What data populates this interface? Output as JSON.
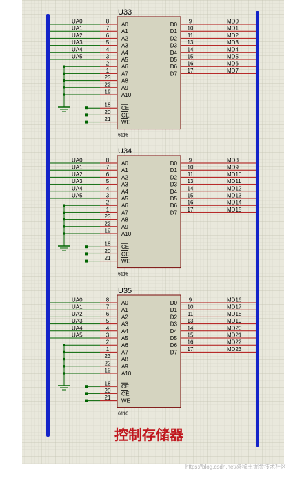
{
  "caption": "控制存储器",
  "watermark": "https://blog.csdn.net/@稀土掘金技术社区",
  "part_number": "6116",
  "colors": {
    "bus": "#1424c8",
    "wire": "#006400",
    "signal_wire": "#b01010",
    "chip_fill": "#d5d4c0",
    "grid_bg": "#e9e8dc",
    "caption": "#c0181f"
  },
  "chips": [
    {
      "title": "U33",
      "left_pins": [
        {
          "num": "8",
          "name": "A0",
          "net": "UA0"
        },
        {
          "num": "7",
          "name": "A1",
          "net": "UA1"
        },
        {
          "num": "6",
          "name": "A2",
          "net": "UA2"
        },
        {
          "num": "5",
          "name": "A3",
          "net": "UA3"
        },
        {
          "num": "4",
          "name": "A4",
          "net": "UA4"
        },
        {
          "num": "3",
          "name": "A5",
          "net": "UA5"
        },
        {
          "num": "2",
          "name": "A6",
          "net": ""
        },
        {
          "num": "1",
          "name": "A7",
          "net": ""
        },
        {
          "num": "23",
          "name": "A8",
          "net": ""
        },
        {
          "num": "22",
          "name": "A9",
          "net": ""
        },
        {
          "num": "19",
          "name": "A10",
          "net": ""
        },
        {
          "num": "18",
          "name": "CE",
          "net": ""
        },
        {
          "num": "20",
          "name": "OE",
          "net": ""
        },
        {
          "num": "21",
          "name": "WE",
          "net": ""
        }
      ],
      "right_pins": [
        {
          "num": "9",
          "name": "D0",
          "net": "MD0"
        },
        {
          "num": "10",
          "name": "D1",
          "net": "MD1"
        },
        {
          "num": "11",
          "name": "D2",
          "net": "MD2"
        },
        {
          "num": "13",
          "name": "D3",
          "net": "MD3"
        },
        {
          "num": "14",
          "name": "D4",
          "net": "MD4"
        },
        {
          "num": "15",
          "name": "D5",
          "net": "MD5"
        },
        {
          "num": "16",
          "name": "D6",
          "net": "MD6"
        },
        {
          "num": "17",
          "name": "D7",
          "net": "MD7"
        }
      ]
    },
    {
      "title": "U34",
      "left_pins": [
        {
          "num": "8",
          "name": "A0",
          "net": "UA0"
        },
        {
          "num": "7",
          "name": "A1",
          "net": "UA1"
        },
        {
          "num": "6",
          "name": "A2",
          "net": "UA2"
        },
        {
          "num": "5",
          "name": "A3",
          "net": "UA3"
        },
        {
          "num": "4",
          "name": "A4",
          "net": "UA4"
        },
        {
          "num": "3",
          "name": "A5",
          "net": "UA5"
        },
        {
          "num": "2",
          "name": "A6",
          "net": ""
        },
        {
          "num": "1",
          "name": "A7",
          "net": ""
        },
        {
          "num": "23",
          "name": "A8",
          "net": ""
        },
        {
          "num": "22",
          "name": "A9",
          "net": ""
        },
        {
          "num": "19",
          "name": "A10",
          "net": ""
        },
        {
          "num": "18",
          "name": "CE",
          "net": ""
        },
        {
          "num": "20",
          "name": "OE",
          "net": ""
        },
        {
          "num": "21",
          "name": "WE",
          "net": ""
        }
      ],
      "right_pins": [
        {
          "num": "9",
          "name": "D0",
          "net": "MD8"
        },
        {
          "num": "10",
          "name": "D1",
          "net": "MD9"
        },
        {
          "num": "11",
          "name": "D2",
          "net": "MD10"
        },
        {
          "num": "13",
          "name": "D3",
          "net": "MD11"
        },
        {
          "num": "14",
          "name": "D4",
          "net": "MD12"
        },
        {
          "num": "15",
          "name": "D5",
          "net": "MD13"
        },
        {
          "num": "16",
          "name": "D6",
          "net": "MD14"
        },
        {
          "num": "17",
          "name": "D7",
          "net": "MD15"
        }
      ]
    },
    {
      "title": "U35",
      "left_pins": [
        {
          "num": "8",
          "name": "A0",
          "net": "UA0"
        },
        {
          "num": "7",
          "name": "A1",
          "net": "UA1"
        },
        {
          "num": "6",
          "name": "A2",
          "net": "UA2"
        },
        {
          "num": "5",
          "name": "A3",
          "net": "UA3"
        },
        {
          "num": "4",
          "name": "A4",
          "net": "UA4"
        },
        {
          "num": "3",
          "name": "A5",
          "net": "UA5"
        },
        {
          "num": "2",
          "name": "A6",
          "net": ""
        },
        {
          "num": "1",
          "name": "A7",
          "net": ""
        },
        {
          "num": "23",
          "name": "A8",
          "net": ""
        },
        {
          "num": "22",
          "name": "A9",
          "net": ""
        },
        {
          "num": "19",
          "name": "A10",
          "net": ""
        },
        {
          "num": "18",
          "name": "CE",
          "net": ""
        },
        {
          "num": "20",
          "name": "OE",
          "net": ""
        },
        {
          "num": "21",
          "name": "WE",
          "net": ""
        }
      ],
      "right_pins": [
        {
          "num": "9",
          "name": "D0",
          "net": "MD16"
        },
        {
          "num": "10",
          "name": "D1",
          "net": "MD17"
        },
        {
          "num": "11",
          "name": "D2",
          "net": "MD18"
        },
        {
          "num": "13",
          "name": "D3",
          "net": "MD19"
        },
        {
          "num": "14",
          "name": "D4",
          "net": "MD20"
        },
        {
          "num": "15",
          "name": "D5",
          "net": "MD21"
        },
        {
          "num": "16",
          "name": "D6",
          "net": "MD22"
        },
        {
          "num": "17",
          "name": "D7",
          "net": "MD23"
        }
      ]
    }
  ]
}
